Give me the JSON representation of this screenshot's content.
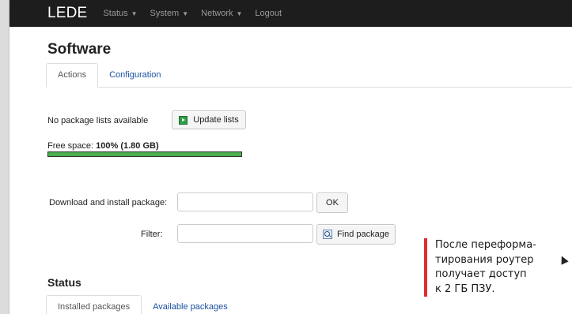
{
  "navbar": {
    "brand": "LEDE",
    "items": [
      {
        "label": "Status",
        "has_caret": true
      },
      {
        "label": "System",
        "has_caret": true
      },
      {
        "label": "Network",
        "has_caret": true
      },
      {
        "label": "Logout",
        "has_caret": false
      }
    ]
  },
  "page": {
    "title": "Software",
    "tabs": [
      {
        "label": "Actions",
        "active": true
      },
      {
        "label": "Configuration",
        "active": false
      }
    ]
  },
  "actions": {
    "package_lists_status": "No package lists available",
    "update_button_label": "Update lists",
    "free_space_label": "Free space: ",
    "free_space_percent": "100%",
    "free_space_size": "(1.80 GB)",
    "free_space_fraction": 1.0,
    "download_label": "Download and install package:",
    "download_value": "",
    "ok_button_label": "OK",
    "filter_label": "Filter:",
    "filter_value": "",
    "find_button_label": "Find package"
  },
  "status_section": {
    "title": "Status",
    "tabs": [
      {
        "label": "Installed packages",
        "active": true
      },
      {
        "label": "Available packages",
        "active": false
      }
    ]
  },
  "annotation": {
    "lines": [
      "После переформа-",
      "тирования роутер",
      "получает доступ",
      "к 2 ГБ ПЗУ."
    ]
  },
  "colors": {
    "navbar_bg": "#1d1d1d",
    "progress_fill": "#4caf50",
    "annotation_bar": "#e02b2b",
    "link": "#1a4fa0"
  }
}
